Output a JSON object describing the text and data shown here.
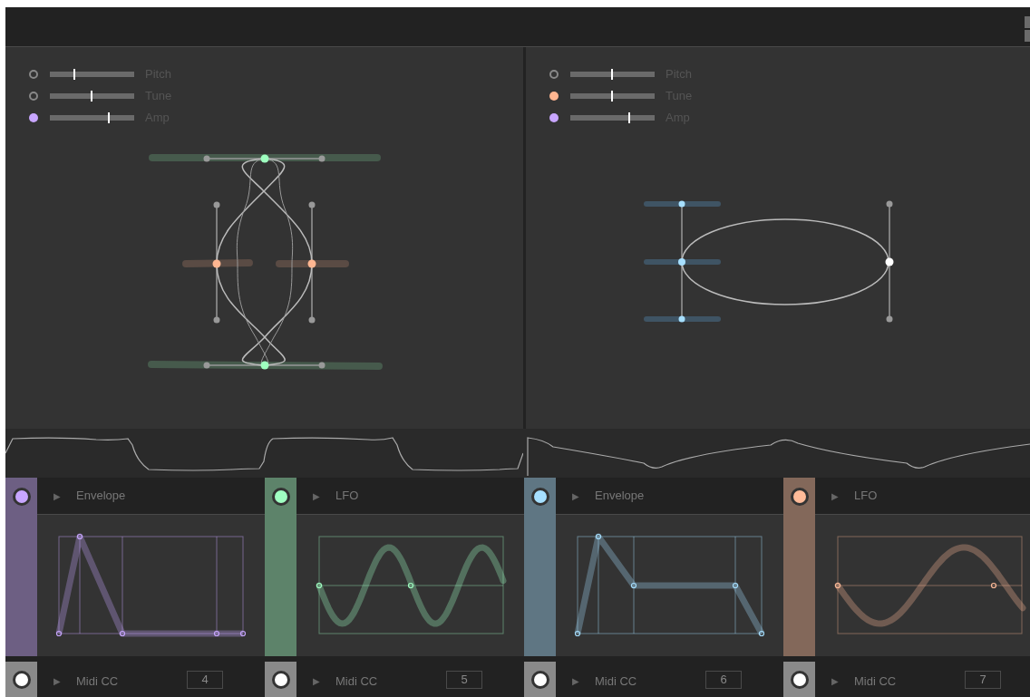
{
  "panels": [
    {
      "params": [
        {
          "label": "Pitch",
          "kind": "empty",
          "level": 0.29
        },
        {
          "label": "Tune",
          "kind": "empty",
          "level": 0.49
        },
        {
          "label": "Amp",
          "kind": "filled",
          "color": "#c8a6ff",
          "level": 0.7
        }
      ]
    },
    {
      "params": [
        {
          "label": "Pitch",
          "kind": "empty",
          "level": 0.49
        },
        {
          "label": "Tune",
          "kind": "filled",
          "color": "#ffb691",
          "level": 0.49
        },
        {
          "label": "Amp",
          "kind": "filled",
          "color": "#c8a6ff",
          "level": 0.7
        }
      ]
    }
  ],
  "modules": [
    {
      "kind": "envelope",
      "arrow": "▶",
      "title": "Envelope",
      "color": "#c8a6ff",
      "midi": {
        "arrow": "▶",
        "label": "Midi CC",
        "value": "4"
      }
    },
    {
      "kind": "lfo",
      "arrow": "▶",
      "title": "LFO",
      "color": "#a0ffc2",
      "midi": {
        "arrow": "▶",
        "label": "Midi CC",
        "value": "5"
      }
    },
    {
      "kind": "envelope",
      "arrow": "▶",
      "title": "Envelope",
      "color": "#a6dfff",
      "midi": {
        "arrow": "▶",
        "label": "Midi CC",
        "value": "6"
      }
    },
    {
      "kind": "lfo",
      "arrow": "▶",
      "title": "LFO",
      "color": "#ffbb99",
      "midi": {
        "arrow": "▶",
        "label": "Midi CC",
        "value": "7"
      }
    }
  ]
}
